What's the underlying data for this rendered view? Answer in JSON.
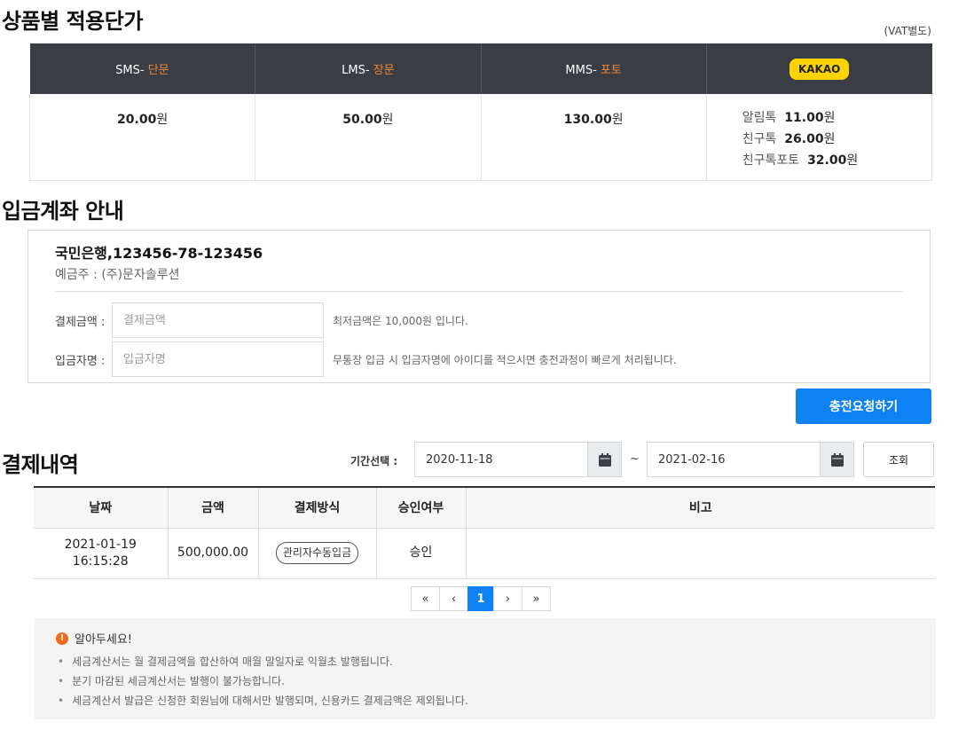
{
  "pricing": {
    "title": "상품별 적용단가",
    "vat_note": "(VAT별도)",
    "headers": [
      {
        "prefix": "SMS-",
        "accent": "단문"
      },
      {
        "prefix": "LMS-",
        "accent": "장문"
      },
      {
        "prefix": "MMS-",
        "accent": "포토"
      }
    ],
    "kakao_label": "KAKAO",
    "values": [
      {
        "amount": "20.00",
        "unit": "원"
      },
      {
        "amount": "50.00",
        "unit": "원"
      },
      {
        "amount": "130.00",
        "unit": "원"
      }
    ],
    "kakao_items": [
      {
        "label": "알림톡",
        "amount": "11.00",
        "unit": "원"
      },
      {
        "label": "친구톡",
        "amount": "26.00",
        "unit": "원"
      },
      {
        "label": "친구톡포토",
        "amount": "32.00",
        "unit": "원"
      }
    ]
  },
  "account": {
    "title": "입금계좌 안내",
    "bank": "국민은행,123456-78-123456",
    "holder": "예금주 : (주)문자솔루션",
    "amount_label": "결제금액 :",
    "amount_placeholder": "결제금액",
    "amount_hint": "최저금액은 10,000원 입니다.",
    "depositor_label": "입금자명 :",
    "depositor_placeholder": "입금자명",
    "depositor_hint": "무통장 입금 시 입금자명에 아이디를 적으시면 충전과정이 빠르게 처리됩니다.",
    "charge_button": "충전요청하기"
  },
  "history": {
    "title": "결제내역",
    "period_label": "기간선택 :",
    "date_from": "2020-11-18",
    "date_to": "2021-02-16",
    "tilde": "~",
    "search_button": "조회",
    "columns": [
      "날짜",
      "금액",
      "결제방식",
      "승인여부",
      "비고"
    ],
    "rows": [
      {
        "date": "2021-01-19 16:15:28",
        "amount": "500,000.00",
        "method": "관리자수동입금",
        "status": "승인",
        "note": ""
      }
    ],
    "pager": {
      "first": "«",
      "prev": "‹",
      "current": "1",
      "next": "›",
      "last": "»"
    }
  },
  "notice": {
    "title": "알아두세요!",
    "icon_glyph": "!",
    "items": [
      "세금계산서는 월 결제금액을 합산하여 매월 말일자로 익월초 발행됩니다.",
      "분기 마감된 세금계산서는 발행이 불가능합니다.",
      "세금계산서 발급은 신청한 회원님에 대해서만 발행되며, 신용카드 결제금액은 제외됩니다."
    ]
  },
  "colors": {
    "accent_blue": "#0c82f5",
    "header_dark": "#3a3d44",
    "orange": "#f08a3c",
    "kakao_yellow": "#ffd300"
  }
}
